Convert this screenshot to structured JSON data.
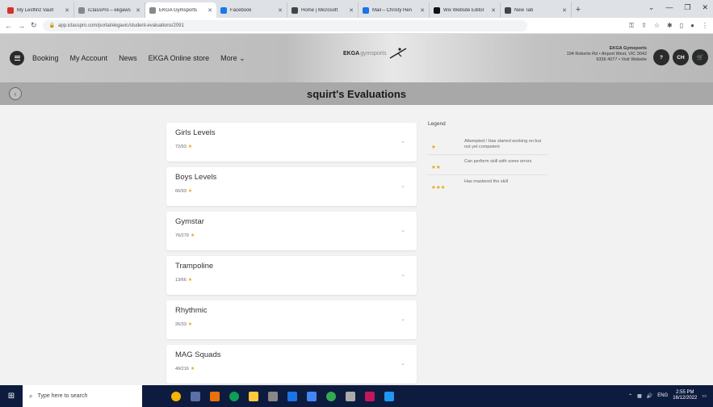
{
  "browser": {
    "tabs": [
      {
        "label": "My Lesffinz Vault",
        "active": false,
        "color": "#d93025"
      },
      {
        "label": "iClassPro – ekgaws",
        "active": false,
        "color": "#888888"
      },
      {
        "label": "EKGA Gymsports",
        "active": true,
        "color": "#888888"
      },
      {
        "label": "Facebook",
        "active": false,
        "color": "#1877f2"
      },
      {
        "label": "Home | Microsoft",
        "active": false,
        "color": "#444444"
      },
      {
        "label": "Mail – Christy Hen",
        "active": false,
        "color": "#1a73e8"
      },
      {
        "label": "Wix Website Editor",
        "active": false,
        "color": "#111111"
      },
      {
        "label": "New Tab",
        "active": false,
        "color": "#444444"
      }
    ],
    "url": "app.iclasspro.com/portal/ekgavic/student-evaluations/2091"
  },
  "header": {
    "nav": [
      {
        "label": "Booking"
      },
      {
        "label": "My Account"
      },
      {
        "label": "News"
      },
      {
        "label": "EKGA Online store"
      },
      {
        "label": "More"
      }
    ],
    "logo_main": "EKGA",
    "logo_sub": "gymsports",
    "address_name": "EKGA Gymsports",
    "address_line1": "194 Roberts Rd • Airport West, VIC 3042",
    "address_line2": "9336 4077 • Visit Website",
    "avatar_initials": "CH"
  },
  "title": "squirt's Evaluations",
  "evaluations": [
    {
      "name": "Girls Levels",
      "score": "72/93"
    },
    {
      "name": "Boys Levels",
      "score": "66/93"
    },
    {
      "name": "Gymstar",
      "score": "76/279"
    },
    {
      "name": "Trampoline",
      "score": "13/66"
    },
    {
      "name": "Rhythmic",
      "score": "26/33"
    },
    {
      "name": "MAG Squads",
      "score": "49/216"
    }
  ],
  "legend": {
    "title": "Legend",
    "rows": [
      {
        "stars": "★",
        "text": "Attempted / Has started working on but not yet competent"
      },
      {
        "stars": "★★",
        "text": "Can perform skill with some errors"
      },
      {
        "stars": "★★★",
        "text": "Has mastered the skill"
      }
    ]
  },
  "taskbar": {
    "search_placeholder": "Type here to search",
    "lang": "ENG",
    "time": "2:55 PM",
    "date": "16/12/2022"
  }
}
